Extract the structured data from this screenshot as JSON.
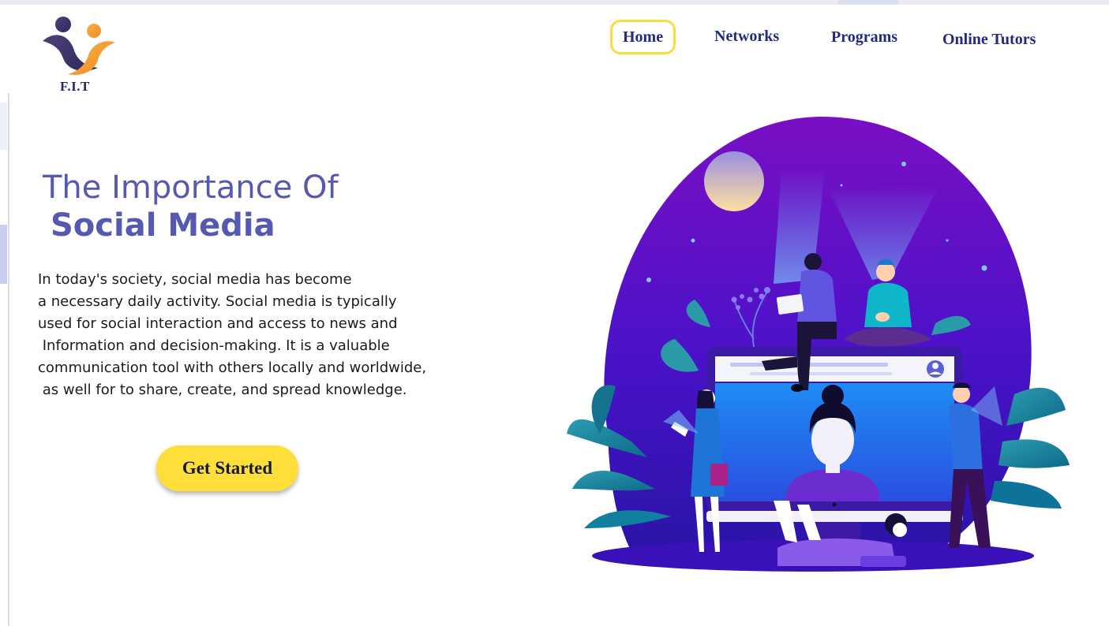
{
  "brand": {
    "logo_text": "F.I.T"
  },
  "nav": {
    "items": [
      {
        "label": "Home",
        "active": true
      },
      {
        "label": "Networks",
        "active": false
      },
      {
        "label": "Programs",
        "active": false
      },
      {
        "label": "Online Tutors",
        "active": false
      }
    ]
  },
  "hero": {
    "title_line1": "The Importance Of",
    "title_line2": "Social Media",
    "body": "In today's society, social media has become\na necessary daily activity. Social media is typically\nused for social interaction and access to news and\n Information and decision-making. It is a valuable\ncommunication tool with others locally and worldwide,\n as well for to share, create, and spread knowledge.",
    "cta_label": "Get Started"
  },
  "colors": {
    "accent_yellow": "#fedf3a",
    "nav_text": "#232a80",
    "title_purple": "#5659b2",
    "illustration_purple": "#5a0bc4",
    "illustration_blue": "#1e78f0"
  },
  "icons": {
    "logo": "people-logo-icon",
    "illustration": "social-media-illustration"
  }
}
